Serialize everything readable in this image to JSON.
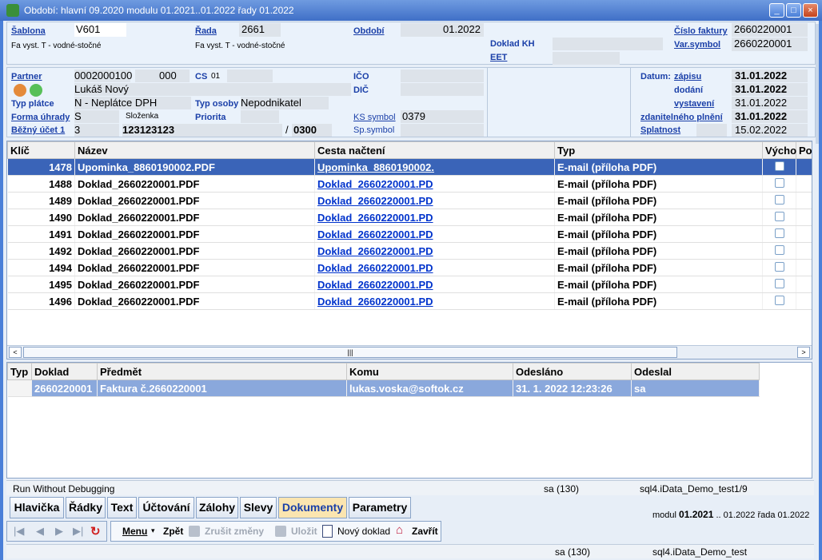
{
  "window": {
    "title": "Období: hlavní 09.2020 modulu 01.2021..01.2022 řady 01.2022",
    "buttons": [
      "_",
      "□",
      "×"
    ]
  },
  "header": {
    "sablona_label": "Šablona",
    "sablona_value": "V601",
    "sablona_desc": "Fa vyst. T - vodné-stočné",
    "rada_label": "Řada",
    "rada_value": "2661",
    "rada_desc": "Fa  vyst. T - vodné-stočné",
    "obdobi_label": "Období",
    "obdobi_value": "01.2022",
    "doklad_kh_label": "Doklad KH",
    "eet_label": "EET",
    "cislo_faktury_label": "Číslo faktury",
    "cislo_faktury_value": "2660220001",
    "var_symbol_label": "Var.symbol",
    "var_symbol_value": "2660220001"
  },
  "partner": {
    "partner_label": "Partner",
    "partner_value": "0002000100",
    "partner_sub": "000",
    "cs_label": "CS",
    "cs_value": "01",
    "name": "Lukáš Nový",
    "typ_platce_label": "Typ plátce",
    "typ_platce_value": "N - Neplátce DPH",
    "typ_osoby_label": "Typ osoby",
    "typ_osoby_value": "Nepodnikatel",
    "forma_uhrady_label": "Forma úhrady",
    "forma_uhrady_value": "S",
    "forma_uhrady_desc": "Složenka",
    "priorita_label": "Priorita",
    "bezny_ucet_label": "Běžný účet 1",
    "bezny_ucet_value": "3",
    "bezny_ucet_number": "123123123",
    "bank_sep": "/",
    "bank_code": "0300",
    "ico_label": "IČO",
    "dic_label": "DIČ",
    "ks_label": "KS symbol",
    "ks_value": "0379",
    "sp_label": "Sp.symbol"
  },
  "dates": {
    "datum_label": "Datum:",
    "zapisu_label": "zápisu",
    "zapisu_value": "31.01.2022",
    "dodani_label": "dodání",
    "dodani_value": "31.01.2022",
    "vystaveni_label": "vystavení",
    "vystaveni_value": "31.01.2022",
    "zdanitelneho_label": "zdanitelného plnění",
    "zdanitelneho_value": "31.01.2022",
    "splatnost_label": "Splatnost",
    "splatnost_value": "15.02.2022"
  },
  "docs_table": {
    "columns": [
      "Klíč",
      "Název",
      "Cesta načtení",
      "Typ",
      "Výcho",
      "Po"
    ],
    "rows": [
      {
        "key": "1478",
        "name": "Upominka_8860190002.PDF",
        "path": "Upominka_8860190002.",
        "type": "E-mail (příloha PDF)"
      },
      {
        "key": "1488",
        "name": "Doklad_2660220001.PDF",
        "path": "Doklad_2660220001.PD",
        "type": "E-mail (příloha PDF)"
      },
      {
        "key": "1489",
        "name": "Doklad_2660220001.PDF",
        "path": "Doklad_2660220001.PD",
        "type": "E-mail (příloha PDF)"
      },
      {
        "key": "1490",
        "name": "Doklad_2660220001.PDF",
        "path": "Doklad_2660220001.PD",
        "type": "E-mail (příloha PDF)"
      },
      {
        "key": "1491",
        "name": "Doklad_2660220001.PDF",
        "path": "Doklad_2660220001.PD",
        "type": "E-mail (příloha PDF)"
      },
      {
        "key": "1492",
        "name": "Doklad_2660220001.PDF",
        "path": "Doklad_2660220001.PD",
        "type": "E-mail (příloha PDF)"
      },
      {
        "key": "1494",
        "name": "Doklad_2660220001.PDF",
        "path": "Doklad_2660220001.PD",
        "type": "E-mail (příloha PDF)"
      },
      {
        "key": "1495",
        "name": "Doklad_2660220001.PDF",
        "path": "Doklad_2660220001.PD",
        "type": "E-mail (příloha PDF)"
      },
      {
        "key": "1496",
        "name": "Doklad_2660220001.PDF",
        "path": "Doklad_2660220001.PD",
        "type": "E-mail (příloha PDF)"
      }
    ]
  },
  "mail_table": {
    "columns": [
      "Typ",
      "Doklad",
      "Předmět",
      "Komu",
      "Odesláno",
      "Odeslal"
    ],
    "rows": [
      {
        "typ": "",
        "doklad": "2660220001",
        "predmet": "Faktura č.2660220001",
        "komu": "lukas.voska@softok.cz",
        "odeslano": "31. 1. 2022 12:23:26",
        "odeslal": "sa"
      }
    ]
  },
  "status_bar_1": {
    "left": "Run Without Debugging",
    "user": "sa (130)",
    "db": "sql4.iData_Demo_test",
    "page": "1/9"
  },
  "tabs": [
    "Hlavička",
    "Řádky",
    "Text",
    "Účtování",
    "Zálohy",
    "Slevy",
    "Dokumenty",
    "Parametry"
  ],
  "active_tab": "Dokumenty",
  "module_info": {
    "modul_label": "modul",
    "modul_value": "01.2021",
    "range": "..  01.2022",
    "rada": "řada 01.2022"
  },
  "toolbar": {
    "menu_label": "Menu",
    "zpet_label": "Zpět",
    "zrusit_label": "Zrušit změny",
    "ulozit_label": "Uložit",
    "novy_label": "Nový doklad",
    "zavrit_label": "Zavřít"
  },
  "status_bar_2": {
    "user": "sa (130)",
    "db": "sql4.iData_Demo_test"
  },
  "colors": {
    "selected_row": "#3a64b8",
    "active_tab": "#fbe5b0",
    "label_blue": "#1a3fa8"
  }
}
